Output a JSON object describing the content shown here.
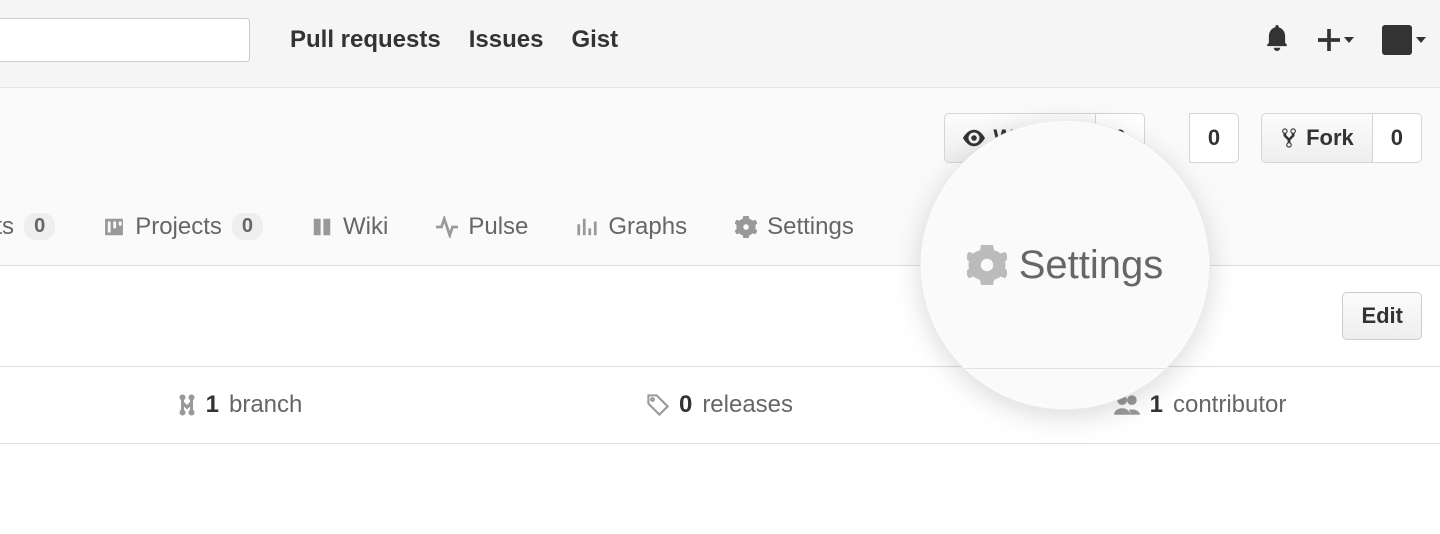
{
  "header": {
    "search_placeholder": "",
    "nav": {
      "pull_requests": "Pull requests",
      "issues": "Issues",
      "gist": "Gist"
    }
  },
  "repo_actions": {
    "watch": {
      "label": "Watch",
      "count": "0"
    },
    "star": {
      "count": "0"
    },
    "fork": {
      "label": "Fork",
      "count": "0"
    }
  },
  "tabs": {
    "pull_requests_partial": "equests",
    "pull_requests_count": "0",
    "projects": "Projects",
    "projects_count": "0",
    "wiki": "Wiki",
    "pulse": "Pulse",
    "graphs": "Graphs",
    "settings": "Settings"
  },
  "edit_button": "Edit",
  "summary": {
    "branches": {
      "count": "1",
      "label": "branch"
    },
    "releases": {
      "count": "0",
      "label": "releases"
    },
    "contributors": {
      "count": "1",
      "label": "contributor"
    }
  },
  "magnifier": {
    "label": "Settings"
  }
}
